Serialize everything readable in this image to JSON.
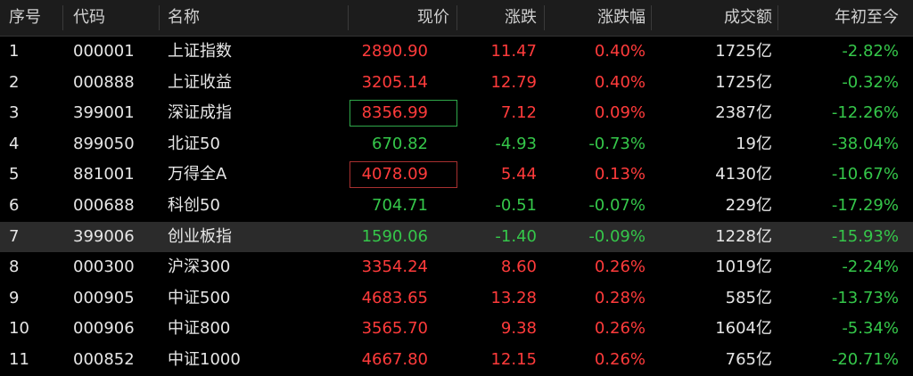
{
  "headers": {
    "idx": "序号",
    "code": "代码",
    "name": "名称",
    "price": "现价",
    "change": "涨跌",
    "pct": "涨跌幅",
    "volume": "成交额",
    "ytd": "年初至今"
  },
  "colors": {
    "up": "#ff3b3b",
    "down": "#35c74a",
    "selected_row": "#2b2b2b"
  },
  "rows": [
    {
      "idx": "1",
      "code": "000001",
      "name": "上证指数",
      "price": "2890.90",
      "change": "11.47",
      "pct": "0.40%",
      "volume": "1725亿",
      "ytd": "-2.82%",
      "dir": "up",
      "ytd_dir": "down",
      "box": ""
    },
    {
      "idx": "2",
      "code": "000888",
      "name": "上证收益",
      "price": "3205.14",
      "change": "12.79",
      "pct": "0.40%",
      "volume": "1725亿",
      "ytd": "-0.32%",
      "dir": "up",
      "ytd_dir": "down",
      "box": ""
    },
    {
      "idx": "3",
      "code": "399001",
      "name": "深证成指",
      "price": "8356.99",
      "change": "7.12",
      "pct": "0.09%",
      "volume": "2387亿",
      "ytd": "-12.26%",
      "dir": "up",
      "ytd_dir": "down",
      "box": "green"
    },
    {
      "idx": "4",
      "code": "899050",
      "name": "北证50",
      "price": "670.82",
      "change": "-4.93",
      "pct": "-0.73%",
      "volume": "19亿",
      "ytd": "-38.04%",
      "dir": "down",
      "ytd_dir": "down",
      "box": ""
    },
    {
      "idx": "5",
      "code": "881001",
      "name": "万得全A",
      "price": "4078.09",
      "change": "5.44",
      "pct": "0.13%",
      "volume": "4130亿",
      "ytd": "-10.67%",
      "dir": "up",
      "ytd_dir": "down",
      "box": "red"
    },
    {
      "idx": "6",
      "code": "000688",
      "name": "科创50",
      "price": "704.71",
      "change": "-0.51",
      "pct": "-0.07%",
      "volume": "229亿",
      "ytd": "-17.29%",
      "dir": "down",
      "ytd_dir": "down",
      "box": ""
    },
    {
      "idx": "7",
      "code": "399006",
      "name": "创业板指",
      "price": "1590.06",
      "change": "-1.40",
      "pct": "-0.09%",
      "volume": "1228亿",
      "ytd": "-15.93%",
      "dir": "down",
      "ytd_dir": "down",
      "box": "",
      "selected": true
    },
    {
      "idx": "8",
      "code": "000300",
      "name": "沪深300",
      "price": "3354.24",
      "change": "8.60",
      "pct": "0.26%",
      "volume": "1019亿",
      "ytd": "-2.24%",
      "dir": "up",
      "ytd_dir": "down",
      "box": ""
    },
    {
      "idx": "9",
      "code": "000905",
      "name": "中证500",
      "price": "4683.65",
      "change": "13.28",
      "pct": "0.28%",
      "volume": "585亿",
      "ytd": "-13.73%",
      "dir": "up",
      "ytd_dir": "down",
      "box": ""
    },
    {
      "idx": "10",
      "code": "000906",
      "name": "中证800",
      "price": "3565.70",
      "change": "9.38",
      "pct": "0.26%",
      "volume": "1604亿",
      "ytd": "-5.34%",
      "dir": "up",
      "ytd_dir": "down",
      "box": ""
    },
    {
      "idx": "11",
      "code": "000852",
      "name": "中证1000",
      "price": "4667.80",
      "change": "12.15",
      "pct": "0.26%",
      "volume": "765亿",
      "ytd": "-20.71%",
      "dir": "up",
      "ytd_dir": "down",
      "box": ""
    }
  ]
}
